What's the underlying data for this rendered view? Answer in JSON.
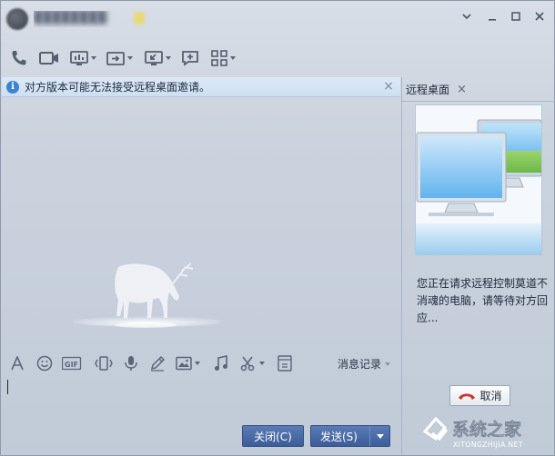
{
  "window": {
    "contact_name": "████████",
    "controls": {
      "menu": "chevron-down-icon",
      "minimize": "minimize-icon",
      "maximize": "maximize-icon",
      "close": "close-icon"
    }
  },
  "toolbar": {
    "icons": [
      "phone-icon",
      "video-icon",
      "screen-share-icon",
      "file-transfer-icon",
      "remote-desktop-icon",
      "add-chat-icon",
      "apps-grid-icon"
    ]
  },
  "notice": {
    "text": "对方版本可能无法接受远程桌面邀请。",
    "close": "×"
  },
  "input_toolbar": {
    "icons": [
      "font-icon",
      "emoji-icon",
      "gif-icon",
      "shake-icon",
      "voice-icon",
      "pen-icon",
      "image-icon",
      "music-icon",
      "scissors-icon",
      "collapse-icon"
    ],
    "history_label": "消息记录"
  },
  "buttons": {
    "close_label": "关闭(C)",
    "send_label": "发送(S)"
  },
  "right_panel": {
    "tab_label": "远程桌面",
    "tab_close": "×",
    "caption": "您正在请求远程控制莫道不消魂的电脑，请等待对方回应...",
    "cancel_label": "取消"
  },
  "watermark": {
    "brand": "系统之家",
    "url": "XITONGZHIJIA.NET"
  },
  "colors": {
    "accent": "#3c5d99",
    "notice_bg": "#d5e4f5",
    "info_icon": "#3c83d0"
  }
}
